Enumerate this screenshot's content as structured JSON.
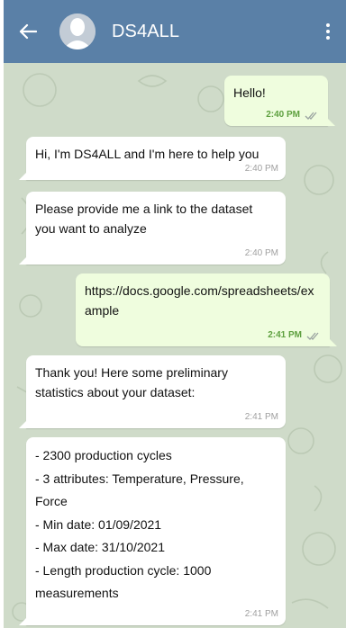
{
  "header": {
    "title": "DS4ALL",
    "back_icon": "arrow-left-icon",
    "menu_icon": "more-vertical-icon",
    "avatar_icon": "user-silhouette-icon"
  },
  "colors": {
    "header_bg": "#5a80a7",
    "chat_bg": "#cfdbc9",
    "incoming_bubble": "#ffffff",
    "outgoing_bubble": "#effdde",
    "outgoing_time": "#5ea03f",
    "incoming_time": "#a0a0a0"
  },
  "messages": [
    {
      "direction": "out",
      "text": "Hello!",
      "time": "2:40 PM"
    },
    {
      "direction": "in",
      "text": "Hi, I'm DS4ALL and I'm here to help you",
      "time": "2:40 PM"
    },
    {
      "direction": "in",
      "text": "Please provide me a link to the dataset you want to analyze",
      "time": "2:40 PM"
    },
    {
      "direction": "out",
      "text": "https://docs.google.com/spreadsheets/example",
      "time": "2:41 PM"
    },
    {
      "direction": "in",
      "text": "Thank you! Here some preliminary statistics about your dataset:",
      "time": "2:41 PM"
    },
    {
      "direction": "in",
      "text": "- 2300 production cycles\n- 3 attributes: Temperature, Pressure, Force\n- Min date: 01/09/2021\n- Max date: 31/10/2021\n- Length production cycle: 1000 measurements",
      "time": "2:41 PM"
    }
  ]
}
